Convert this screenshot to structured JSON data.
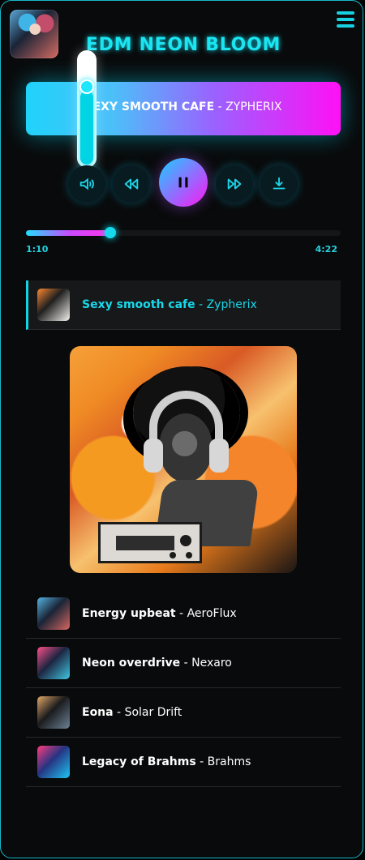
{
  "header": {
    "title": "EDM NEON BLOOM",
    "avatar_icon": "profile-avatar-icon",
    "menu_icon": "hamburger-menu-icon"
  },
  "player": {
    "now_playing_song": "SEXY SMOOTH CAFE",
    "separator": " - ",
    "now_playing_artist": "ZYPHERIX",
    "volume_level": 0.7,
    "current_time": "1:10",
    "total_time": "4:22",
    "progress": 0.267,
    "controls": [
      "volume-icon",
      "rewind-icon",
      "pause-icon",
      "fast-forward-icon",
      "download-icon"
    ]
  },
  "playlist": [
    {
      "title": "Sexy smooth cafe",
      "artist": "Zypherix",
      "active": true
    },
    {
      "title": "Energy upbeat",
      "artist": "AeroFlux"
    },
    {
      "title": "Neon overdrive",
      "artist": "Nexaro"
    },
    {
      "title": "Eona",
      "artist": "Solar Drift"
    },
    {
      "title": "Legacy of Brahms",
      "artist": "Brahms"
    }
  ],
  "colors": {
    "accent": "#18D8EA",
    "magenta": "#FF18EB",
    "background": "#090A0B"
  }
}
